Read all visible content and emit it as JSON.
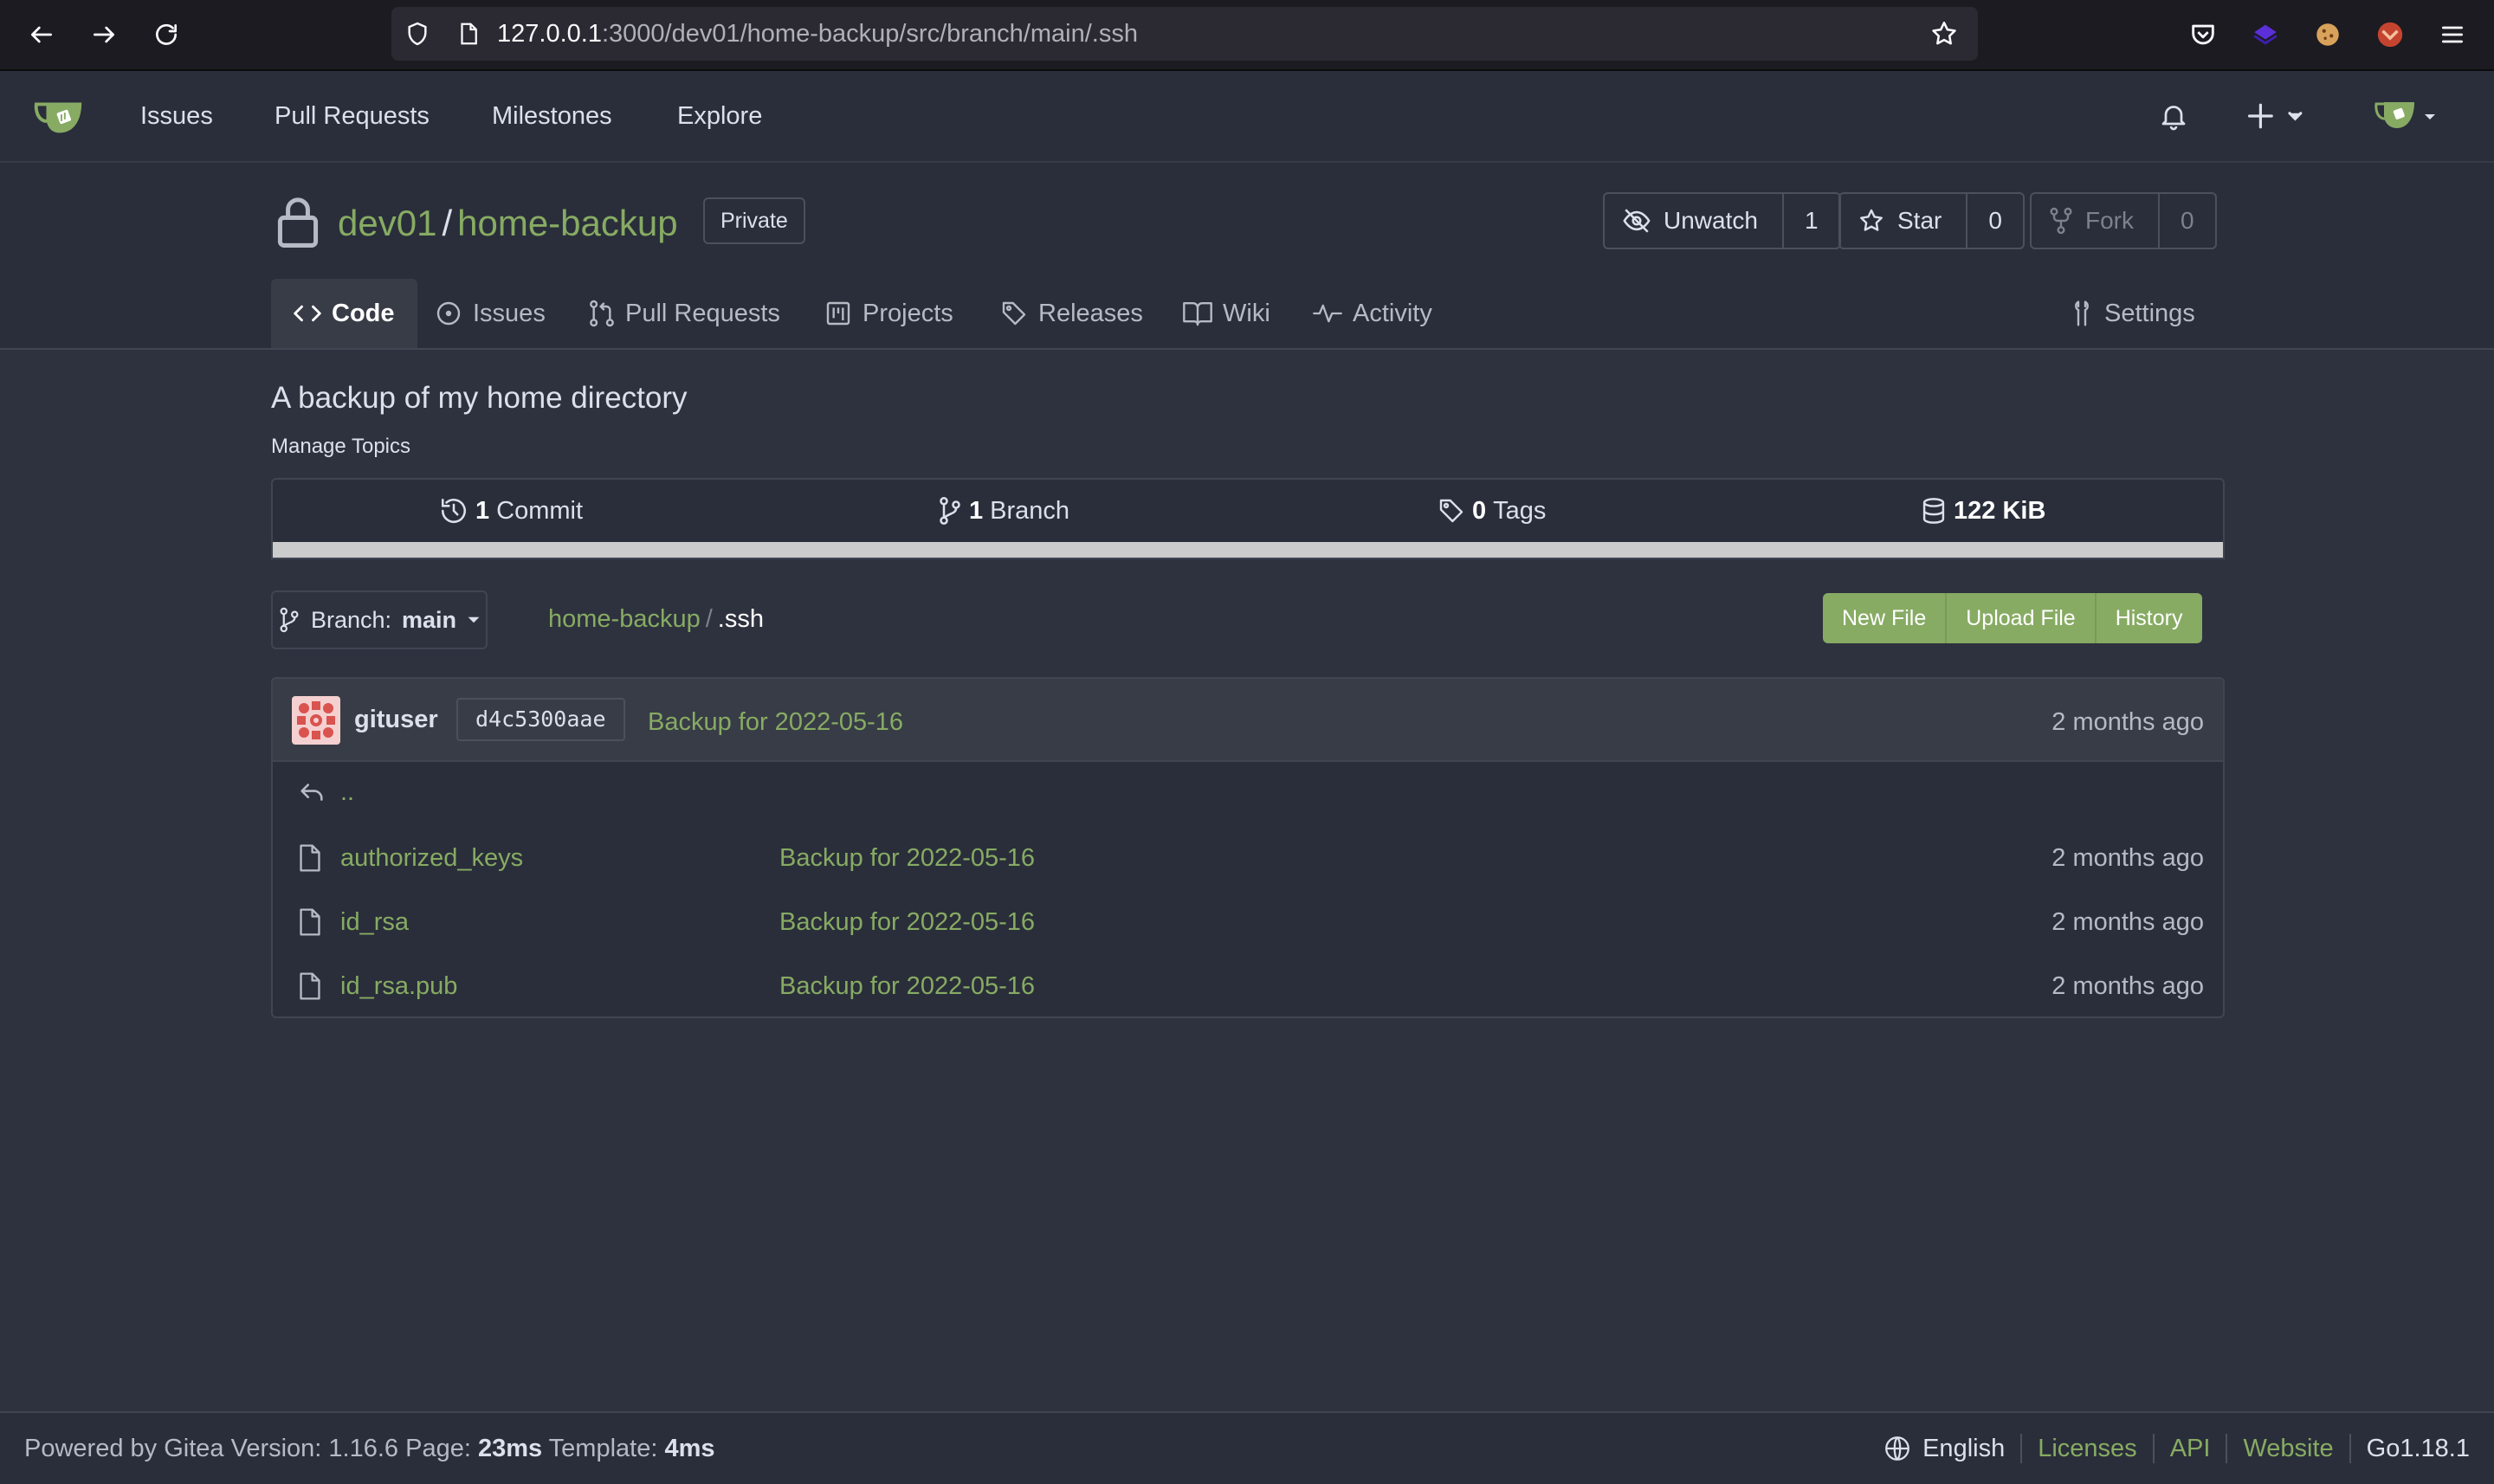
{
  "browser": {
    "url_host": "127.0.0.1",
    "url_rest": ":3000/dev01/home-backup/src/branch/main/.ssh"
  },
  "topnav": {
    "issues": "Issues",
    "pulls": "Pull Requests",
    "milestones": "Milestones",
    "explore": "Explore"
  },
  "repo": {
    "owner": "dev01",
    "sep": "/",
    "name": "home-backup",
    "visibility": "Private",
    "watch_label": "Unwatch",
    "watch_count": "1",
    "star_label": "Star",
    "star_count": "0",
    "fork_label": "Fork",
    "fork_count": "0"
  },
  "tabs": {
    "code": "Code",
    "issues": "Issues",
    "pulls": "Pull Requests",
    "projects": "Projects",
    "releases": "Releases",
    "wiki": "Wiki",
    "activity": "Activity",
    "settings": "Settings"
  },
  "description": "A backup of my home directory",
  "manage_topics": "Manage Topics",
  "stats": {
    "commits_num": "1",
    "commits_label": "Commit",
    "branches_num": "1",
    "branches_label": "Branch",
    "tags_num": "0",
    "tags_label": "Tags",
    "size": "122 KiB"
  },
  "branch": {
    "prefix": "Branch:",
    "name": "main"
  },
  "breadcrumb": {
    "repo": "home-backup",
    "sep": "/",
    "dir": ".ssh"
  },
  "actions": {
    "new_file": "New File",
    "upload_file": "Upload File",
    "history": "History"
  },
  "latest_commit": {
    "author": "gituser",
    "sha": "d4c5300aae",
    "message": "Backup for 2022-05-16",
    "age": "2 months ago"
  },
  "parent_dir": "..",
  "files": [
    {
      "name": "authorized_keys",
      "message": "Backup for 2022-05-16",
      "age": "2 months ago"
    },
    {
      "name": "id_rsa",
      "message": "Backup for 2022-05-16",
      "age": "2 months ago"
    },
    {
      "name": "id_rsa.pub",
      "message": "Backup for 2022-05-16",
      "age": "2 months ago"
    }
  ],
  "footer": {
    "powered": "Powered by Gitea Version: 1.16.6 Page:",
    "page_time": "23ms",
    "template_label": "Template:",
    "template_time": "4ms",
    "language": "English",
    "licenses": "Licenses",
    "api": "API",
    "website": "Website",
    "go_version": "Go1.18.1"
  },
  "colors": {
    "accent": "#87ab63",
    "background": "#2e323e",
    "header": "#2a2e3a"
  }
}
